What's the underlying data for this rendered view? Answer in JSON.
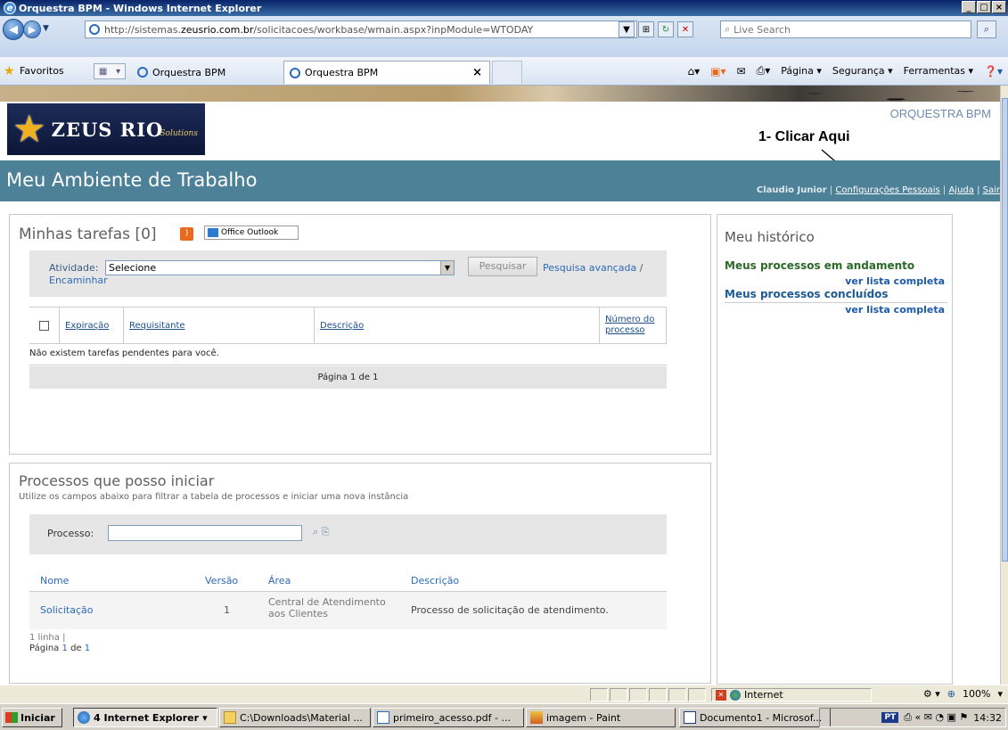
{
  "window": {
    "title": "Orquestra BPM - Windows Internet Explorer"
  },
  "browser": {
    "url_prefix": "http://sistemas.",
    "url_domain": "zeusrio.com.br",
    "url_suffix": "/solicitacoes/workbase/wmain.aspx?inpModule=WTODAY",
    "search_placeholder": "Live Search",
    "favorites_label": "Favoritos",
    "tabs": [
      {
        "label": "Orquestra BPM"
      },
      {
        "label": "Orquestra BPM"
      }
    ],
    "commands": {
      "page": "Página",
      "security": "Segurança",
      "tools": "Ferramentas"
    }
  },
  "banner": {
    "logo_text": "ZEUS RIO",
    "logo_sub": "Solutions",
    "app_name": "ORQUESTRA BPM",
    "annotation": "1- Clicar Aqui"
  },
  "header": {
    "title": "Meu Ambiente de Trabalho",
    "user": "Claudio Junior",
    "links": {
      "settings": "Configurações Pessoais",
      "help": "Ajuda",
      "logout": "Sair"
    }
  },
  "tasks": {
    "title": "Minhas tarefas [0]",
    "outlook_label": "Office Outlook",
    "activity_label": "Atividade:",
    "activity_value": "Selecione",
    "search_button": "Pesquisar",
    "advanced_search": "Pesquisa avançada",
    "forward": "Encaminhar",
    "columns": [
      "Expiração",
      "Requisitante",
      "Descrição",
      "Número do processo"
    ],
    "empty_message": "Não existem tarefas pendentes para você.",
    "pager": "Página 1 de 1"
  },
  "history": {
    "title": "Meu histórico",
    "in_progress": "Meus processos em andamento",
    "completed": "Meus processos concluídos",
    "see_full_list": "ver lista completa"
  },
  "processes": {
    "title": "Processos que posso iniciar",
    "subtitle": "Utilize os campos abaixo para filtrar a tabela de processos e iniciar uma nova instância",
    "process_label": "Processo:",
    "columns": [
      "Nome",
      "Versão",
      "Área",
      "Descrição"
    ],
    "rows": [
      {
        "name": "Solicitação",
        "version": "1",
        "area": "Central de Atendimento aos Clientes",
        "description": "Processo de solicitação de atendimento."
      }
    ],
    "line_count": "1 linha |",
    "pager_prefix": "Página",
    "pager_current": "1",
    "pager_mid": "de",
    "pager_total": "1"
  },
  "statusbar": {
    "zone": "Internet",
    "zoom": "100%"
  },
  "taskbar": {
    "start": "Iniciar",
    "items": [
      {
        "label": "4 Internet Explorer",
        "icon": "ie-icon"
      },
      {
        "label": "C:\\Downloads\\Material ...",
        "icon": "folder-icon"
      },
      {
        "label": "primeiro_acesso.pdf - ...",
        "icon": "pdf-icon"
      },
      {
        "label": "imagem - Paint",
        "icon": "paint-icon"
      },
      {
        "label": "Documento1 - Microsof...",
        "icon": "word-icon"
      }
    ],
    "lang": "PT",
    "clock": "14:32"
  }
}
